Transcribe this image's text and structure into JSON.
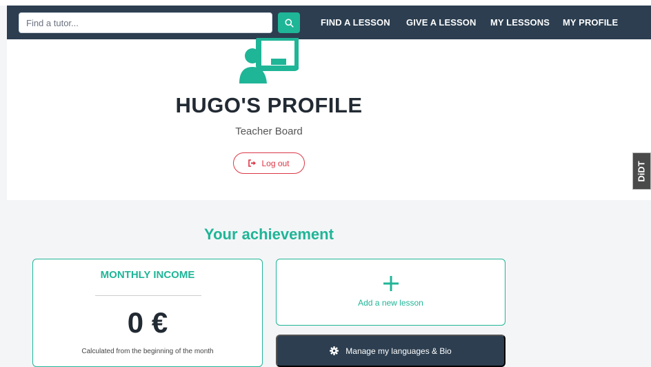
{
  "navbar": {
    "search_placeholder": "Find a tutor...",
    "links": [
      "FIND A LESSON",
      "GIVE A LESSON",
      "MY LESSONS",
      "MY PROFILE"
    ]
  },
  "profile": {
    "title": "HUGO'S PROFILE",
    "subtitle": "Teacher Board",
    "logout_label": "Log out"
  },
  "side_badge": "DiDT",
  "achievement": {
    "section_title": "Your achievement",
    "income_title": "MONTHLY INCOME",
    "income_value": "0 €",
    "income_note": "Calculated from the beginning of the month",
    "add_lesson_label": "Add a new lesson",
    "manage_label": "Manage my languages & Bio"
  },
  "colors": {
    "accent": "#1fb597",
    "navbar_bg": "#2c3e50",
    "danger": "#dc3545"
  },
  "icons": {
    "search": "search-icon",
    "teacher": "teacher-board-icon",
    "logout": "logout-icon",
    "add": "plus-icon",
    "settings": "gear-icon"
  }
}
